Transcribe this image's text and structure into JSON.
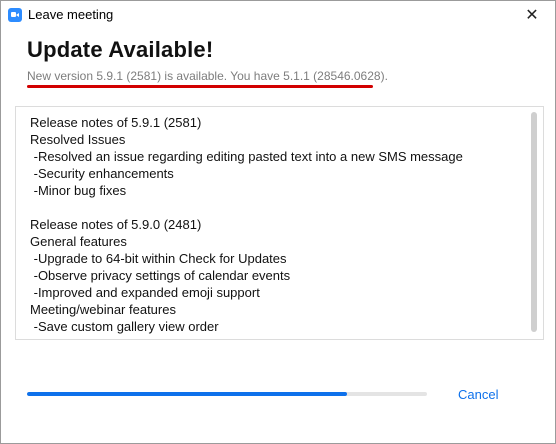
{
  "window": {
    "title": "Leave meeting",
    "close_glyph": "✕",
    "app_icon": "zoom-camera-icon"
  },
  "update": {
    "heading": "Update Available!",
    "subtitle": "New version 5.9.1 (2581) is available. You have 5.1.1 (28546.0628)."
  },
  "release_notes": {
    "lines": [
      "Release notes of 5.9.1 (2581)",
      "Resolved Issues",
      " -Resolved an issue regarding editing pasted text into a new SMS message",
      " -Security enhancements",
      " -Minor bug fixes",
      "",
      "Release notes of 5.9.0 (2481)",
      "General features",
      " -Upgrade to 64-bit within Check for Updates",
      " -Observe privacy settings of calendar events",
      " -Improved and expanded emoji support",
      "Meeting/webinar features",
      " -Save custom gallery view order"
    ]
  },
  "progress": {
    "fraction": 0.8
  },
  "actions": {
    "cancel_label": "Cancel"
  },
  "colors": {
    "accent": "#0e71eb",
    "highlight_underline": "#d20000",
    "subtitle_text": "#7d7d7d"
  }
}
